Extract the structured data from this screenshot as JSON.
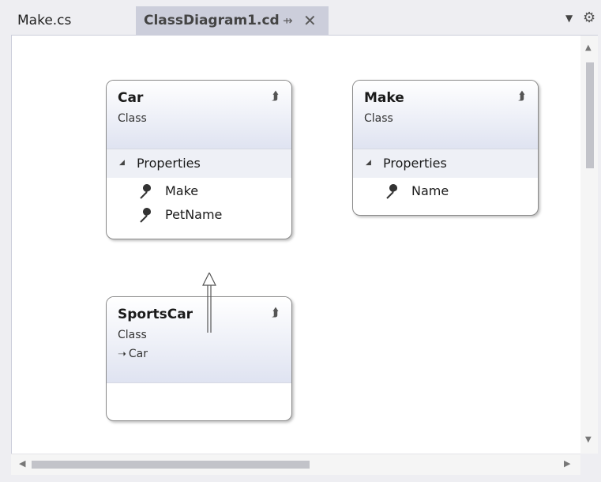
{
  "tabs": [
    {
      "label": "Make.cs",
      "active": false
    },
    {
      "label": "ClassDiagram1.cd",
      "active": true,
      "pin_icon": "pin-icon",
      "close_icon": "close-icon"
    }
  ],
  "toolbar_icons": [
    "chevron-down-icon",
    "gear-icon"
  ],
  "diagram": {
    "classes": [
      {
        "name": "Car",
        "kind": "Class",
        "sections": [
          {
            "label": "Properties",
            "members": [
              "Make",
              "PetName"
            ]
          }
        ]
      },
      {
        "name": "Make",
        "kind": "Class",
        "sections": [
          {
            "label": "Properties",
            "members": [
              "Name"
            ]
          }
        ]
      },
      {
        "name": "SportsCar",
        "kind": "Class",
        "base": "Car",
        "sections": []
      }
    ],
    "relations": [
      {
        "type": "inheritance",
        "from": "SportsCar",
        "to": "Car"
      }
    ]
  },
  "colors": {
    "tab_active_bg": "#cccedb",
    "chrome_bg": "#eeeef2",
    "shape_header_gradient_end": "#dfe3f1",
    "shape_border": "#8a8a8a"
  }
}
